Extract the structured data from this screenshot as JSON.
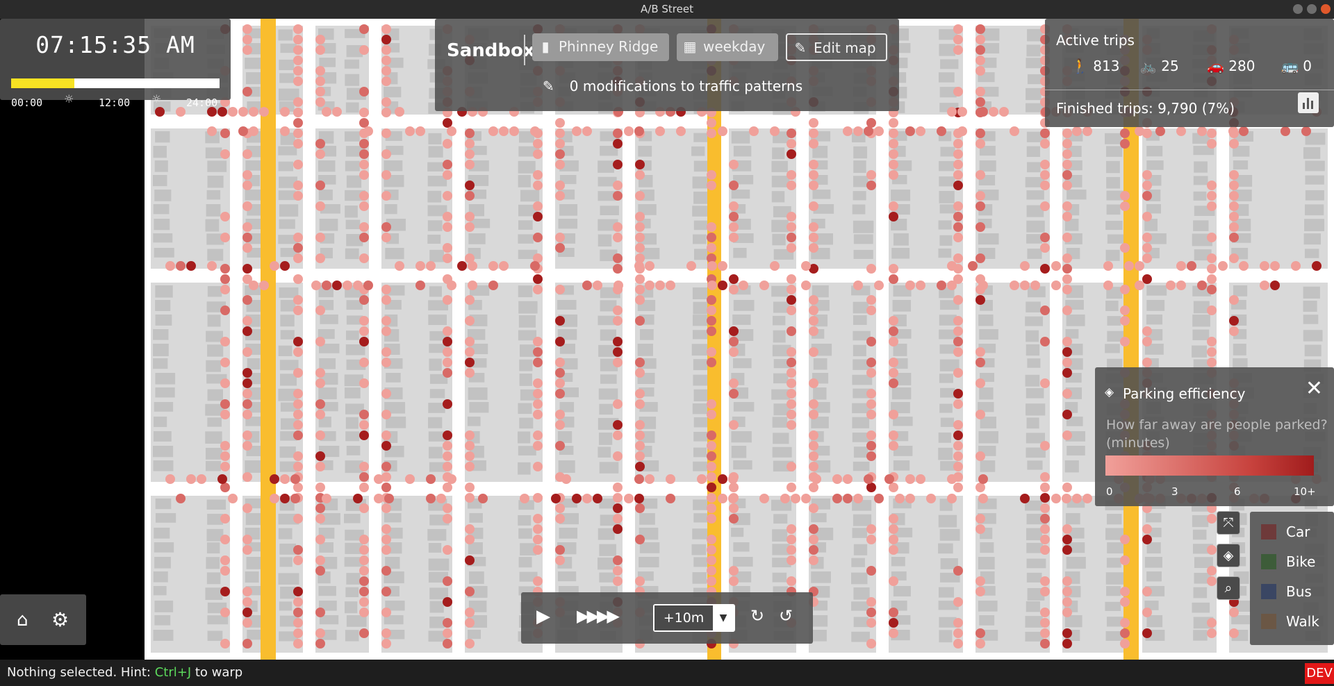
{
  "window": {
    "title": "A/B Street"
  },
  "time_panel": {
    "clock": "07:15:35 AM",
    "progress": 0.302,
    "labels": [
      "00:00",
      "12:00",
      "24:00"
    ]
  },
  "sandbox": {
    "title": "Sandbox",
    "map_label": "Phinney Ridge",
    "scenario_label": "weekday",
    "edit_label": "Edit map",
    "modifications": "0 modifications to traffic patterns"
  },
  "trips": {
    "title": "Active trips",
    "walk": "813",
    "bike": "25",
    "car": "280",
    "bus": "0",
    "finished": "Finished trips: 9,790 (7%)"
  },
  "parking": {
    "title": "Parking efficiency",
    "question": "How far away are people parked? (minutes)",
    "scale": [
      "0",
      "3",
      "6",
      "10+"
    ]
  },
  "legend": [
    {
      "label": "Car",
      "color": "#6e3a3a"
    },
    {
      "label": "Bike",
      "color": "#3d5c39"
    },
    {
      "label": "Bus",
      "color": "#3a4663"
    },
    {
      "label": "Walk",
      "color": "#6b5745"
    }
  ],
  "speed": {
    "step": "+10m"
  },
  "status": {
    "prefix": "Nothing selected. Hint: ",
    "hotkey": "Ctrl+J",
    "suffix": " to warp"
  },
  "dev_badge": "DEV",
  "colors": {
    "arterial": "#f9bd2e",
    "road": "#ffffff",
    "block": "#d9d9d9",
    "building": "#c2c2c2",
    "parking_light": "#f0a09a",
    "parking_dark": "#a51d1d"
  }
}
